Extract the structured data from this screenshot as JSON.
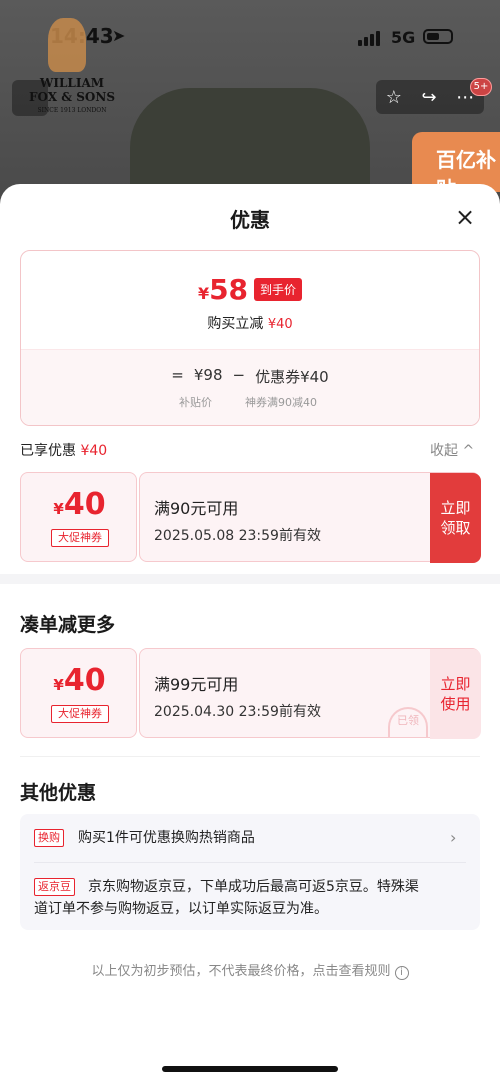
{
  "status": {
    "time": "14:43",
    "network": "5G"
  },
  "brand": {
    "line1": "WILLIAM",
    "line2": "FOX & SONS",
    "line3": "SINCE 1913 LONDON"
  },
  "nav": {
    "badge": "5+"
  },
  "promo_card": {
    "text": "百亿补贴"
  },
  "sheet": {
    "title": "优惠",
    "close": "×"
  },
  "price": {
    "currency": "¥",
    "amount": "58",
    "tag": "到手价",
    "reduce_label": "购买立减",
    "reduce_value": "¥40",
    "eq": "=",
    "base": "¥98",
    "minus": "−",
    "coupon_label": "优惠券¥40",
    "base_sub": "补贴价",
    "coupon_sub": "神券满90减40"
  },
  "enjoyed": {
    "label": "已享优惠",
    "value": "¥40",
    "collapse": "收起 ^"
  },
  "coupon1": {
    "currency": "¥",
    "amount": "40",
    "tag": "大促神券",
    "condition": "满90元可用",
    "valid": "2025.05.08 23:59前有效",
    "button_line1": "立即",
    "button_line2": "领取"
  },
  "section_more": {
    "title": "凑单减更多"
  },
  "coupon2": {
    "currency": "¥",
    "amount": "40",
    "tag": "大促神券",
    "condition": "满99元可用",
    "valid": "2025.04.30 23:59前有效",
    "button_line1": "立即",
    "button_line2": "使用",
    "stamp": "已领"
  },
  "section_other": {
    "title": "其他优惠"
  },
  "other": {
    "item1_tag": "换购",
    "item1_text": "购买1件可优惠换购热销商品",
    "item2_tag": "返京豆",
    "item2_text_a": "京东购物返京豆，下单成功后最高可返5京豆。特殊渠",
    "item2_text_b": "道订单不参与购物返豆，以订单实际返豆为准。"
  },
  "footnote": {
    "text": "以上仅为初步预估，不代表最终价格，点击查看规则",
    "icon": "i"
  }
}
